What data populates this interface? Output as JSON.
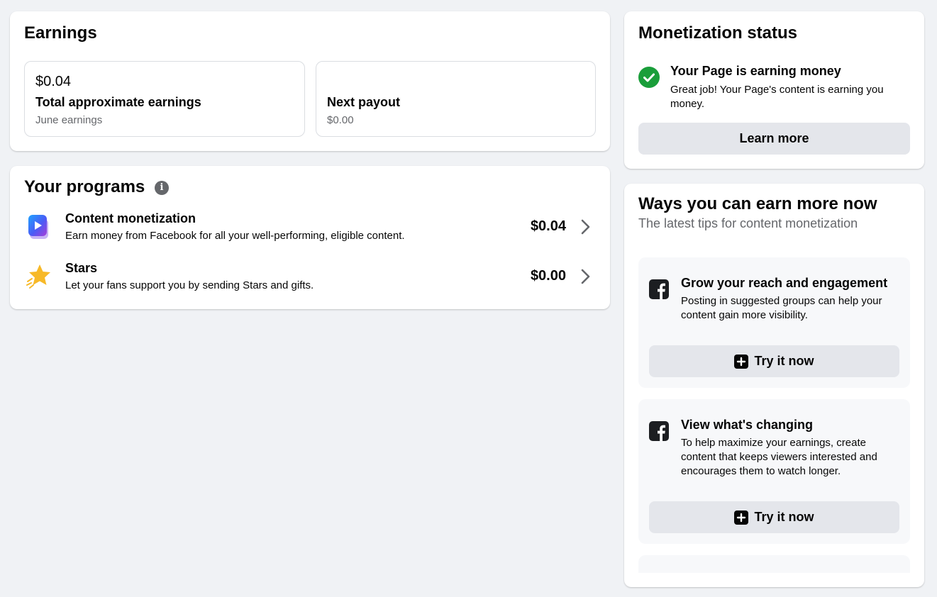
{
  "earnings": {
    "title": "Earnings",
    "total": {
      "value": "$0.04",
      "label": "Total approximate earnings",
      "sub": "June earnings"
    },
    "payout": {
      "value": "",
      "label": "Next payout",
      "sub": "$0.00"
    }
  },
  "programs": {
    "title": "Your programs",
    "items": [
      {
        "title": "Content monetization",
        "desc": "Earn money from Facebook for all your well-performing, eligible content.",
        "amount": "$0.04",
        "icon": "play-video-icon"
      },
      {
        "title": "Stars",
        "desc": "Let your fans support you by sending Stars and gifts.",
        "amount": "$0.00",
        "icon": "star-icon"
      }
    ]
  },
  "monetization": {
    "title": "Monetization status",
    "status_title": "Your Page is earning money",
    "status_desc": "Great job! Your Page's content is earning you money.",
    "learn_more": "Learn more"
  },
  "ways": {
    "title": "Ways you can earn more now",
    "subtitle": "The latest tips for content monetization",
    "tips": [
      {
        "title": "Grow your reach and engagement",
        "desc": "Posting in suggested groups can help your content gain more visibility.",
        "button": "Try it now"
      },
      {
        "title": "View what's changing",
        "desc": "To help maximize your earnings, create content that keeps viewers interested and encourages them to watch longer.",
        "button": "Try it now"
      }
    ]
  },
  "colors": {
    "success_green": "#1a9e3a",
    "button_gray": "#e4e6eb",
    "secondary_text": "#65676b",
    "brand_blue": "#0866ff"
  }
}
